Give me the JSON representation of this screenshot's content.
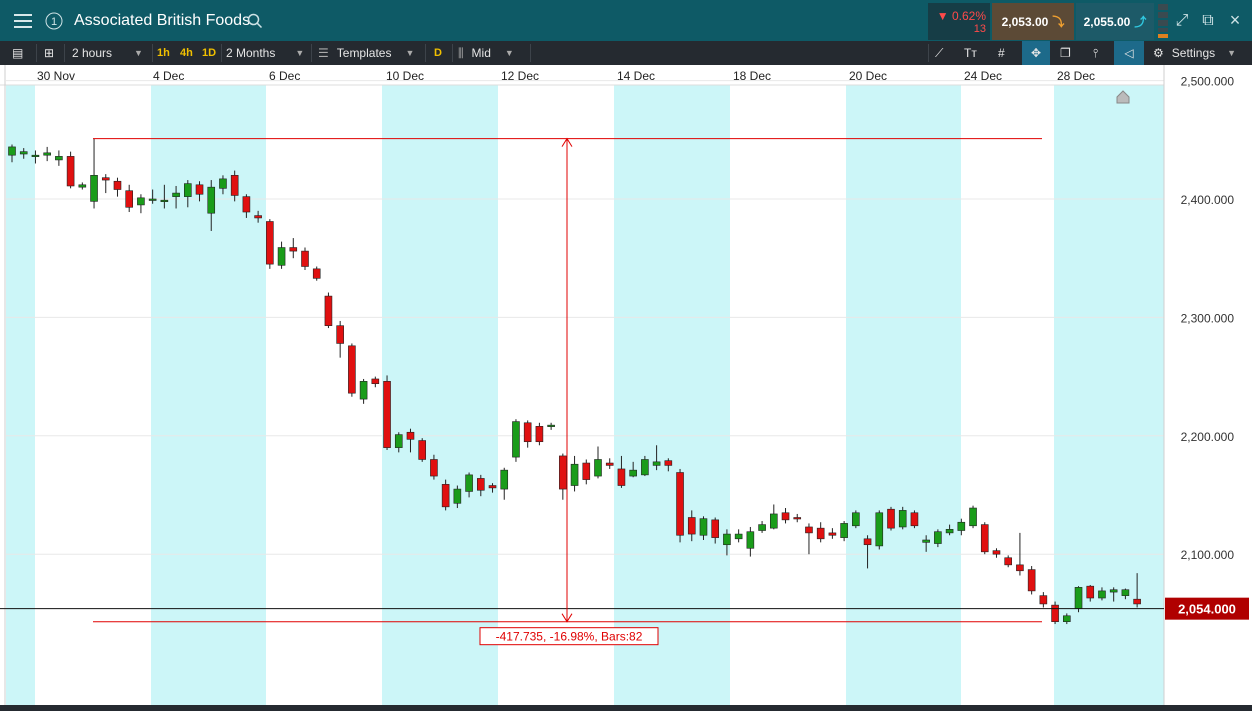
{
  "header": {
    "title": "Associated British Foods",
    "change_pct": "▼ 0.62%",
    "change_abs": "13",
    "sell_price": "2,053.00",
    "buy_price": "2,055.00"
  },
  "toolbar": {
    "interval": "2 hours",
    "quick_1h": "1h",
    "quick_4h": "4h",
    "quick_1d": "1D",
    "range": "2 Months",
    "templates": "Templates",
    "d_badge": "D",
    "price_type": "Mid",
    "settings": "Settings"
  },
  "colors": {
    "up": "#1a9c1a",
    "down": "#e01010",
    "band": "#ccf6f8",
    "measure": "#e00000",
    "price_tag": "#b00000"
  },
  "chart_data": {
    "type": "candlestick",
    "x_labels": [
      "30 Nov",
      "4 Dec",
      "6 Dec",
      "10 Dec",
      "12 Dec",
      "14 Dec",
      "18 Dec",
      "20 Dec",
      "24 Dec",
      "28 Dec"
    ],
    "y_ticks": [
      "2,500.000",
      "2,400.000",
      "2,300.000",
      "2,200.000",
      "2,100.000"
    ],
    "y_tick_values": [
      2500,
      2400,
      2300,
      2200,
      2100
    ],
    "ylim": [
      2030,
      2510
    ],
    "current_price": 2054,
    "current_price_label": "2,054.000",
    "measure": {
      "high": 2451,
      "low": 2043,
      "label": "-417.735, -16.98%, Bars:82"
    },
    "candles": [
      [
        2437,
        2444,
        2431,
        2446
      ],
      [
        2438,
        2440,
        2434,
        2443
      ],
      [
        2436,
        2437,
        2430,
        2441
      ],
      [
        2437,
        2439,
        2432,
        2444
      ],
      [
        2433,
        2436,
        2428,
        2441
      ],
      [
        2436,
        2411,
        2409,
        2440
      ],
      [
        2410,
        2412,
        2408,
        2414
      ],
      [
        2398,
        2420,
        2392,
        2451
      ],
      [
        2418,
        2416,
        2405,
        2421
      ],
      [
        2415,
        2408,
        2402,
        2418
      ],
      [
        2407,
        2393,
        2389,
        2412
      ],
      [
        2395,
        2401,
        2388,
        2404
      ],
      [
        2399,
        2400,
        2396,
        2408
      ],
      [
        2399,
        2399,
        2392,
        2412
      ],
      [
        2402,
        2405,
        2392,
        2411
      ],
      [
        2402,
        2413,
        2393,
        2416
      ],
      [
        2412,
        2404,
        2398,
        2415
      ],
      [
        2388,
        2410,
        2373,
        2416
      ],
      [
        2409,
        2417,
        2404,
        2420
      ],
      [
        2420,
        2403,
        2398,
        2424
      ],
      [
        2402,
        2389,
        2384,
        2404
      ],
      [
        2386,
        2384,
        2380,
        2390
      ],
      [
        2381,
        2345,
        2341,
        2383
      ],
      [
        2344,
        2359,
        2341,
        2364
      ],
      [
        2359,
        2356,
        2350,
        2367
      ],
      [
        2356,
        2343,
        2340,
        2359
      ],
      [
        2341,
        2333,
        2331,
        2343
      ],
      [
        2318,
        2293,
        2291,
        2321
      ],
      [
        2293,
        2278,
        2266,
        2297
      ],
      [
        2276,
        2236,
        2233,
        2278
      ],
      [
        2231,
        2246,
        2227,
        2248
      ],
      [
        2248,
        2244,
        2241,
        2250
      ],
      [
        2246,
        2190,
        2188,
        2251
      ],
      [
        2190,
        2201,
        2186,
        2203
      ],
      [
        2203,
        2197,
        2186,
        2206
      ],
      [
        2196,
        2180,
        2178,
        2198
      ],
      [
        2180,
        2166,
        2163,
        2184
      ],
      [
        2159,
        2140,
        2137,
        2163
      ],
      [
        2143,
        2155,
        2139,
        2158
      ],
      [
        2153,
        2167,
        2148,
        2169
      ],
      [
        2164,
        2154,
        2149,
        2167
      ],
      [
        2158,
        2156,
        2152,
        2160
      ],
      [
        2155,
        2171,
        2146,
        2173
      ],
      [
        2182,
        2212,
        2178,
        2214
      ],
      [
        2211,
        2195,
        2190,
        2213
      ],
      [
        2208,
        2195,
        2192,
        2211
      ],
      [
        2208,
        2209,
        2205,
        2211
      ],
      [
        2183,
        2155,
        2146,
        2185
      ],
      [
        2158,
        2176,
        2153,
        2183
      ],
      [
        2177,
        2163,
        2159,
        2180
      ],
      [
        2166,
        2180,
        2164,
        2191
      ],
      [
        2177,
        2175,
        2172,
        2181
      ],
      [
        2172,
        2158,
        2156,
        2183
      ],
      [
        2166,
        2171,
        2165,
        2178
      ],
      [
        2167,
        2180,
        2166,
        2183
      ],
      [
        2175,
        2178,
        2171,
        2192
      ],
      [
        2179,
        2175,
        2170,
        2181
      ],
      [
        2169,
        2116,
        2110,
        2172
      ],
      [
        2131,
        2117,
        2111,
        2137
      ],
      [
        2116,
        2130,
        2112,
        2132
      ],
      [
        2129,
        2114,
        2109,
        2131
      ],
      [
        2108,
        2117,
        2099,
        2121
      ],
      [
        2113,
        2117,
        2110,
        2121
      ],
      [
        2105,
        2119,
        2098,
        2123
      ],
      [
        2120,
        2125,
        2118,
        2128
      ],
      [
        2122,
        2134,
        2121,
        2142
      ],
      [
        2135,
        2129,
        2126,
        2139
      ],
      [
        2131,
        2130,
        2127,
        2134
      ],
      [
        2123,
        2118,
        2100,
        2126
      ],
      [
        2122,
        2113,
        2110,
        2127
      ],
      [
        2118,
        2116,
        2113,
        2122
      ],
      [
        2114,
        2126,
        2111,
        2128
      ],
      [
        2124,
        2135,
        2122,
        2137
      ],
      [
        2113,
        2108,
        2088,
        2116
      ],
      [
        2107,
        2135,
        2104,
        2137
      ],
      [
        2138,
        2122,
        2120,
        2140
      ],
      [
        2123,
        2137,
        2121,
        2140
      ],
      [
        2135,
        2124,
        2122,
        2137
      ],
      [
        2110,
        2112,
        2102,
        2116
      ],
      [
        2109,
        2119,
        2106,
        2121
      ],
      [
        2118,
        2121,
        2116,
        2125
      ],
      [
        2120,
        2127,
        2116,
        2130
      ],
      [
        2124,
        2139,
        2122,
        2141
      ],
      [
        2125,
        2102,
        2100,
        2127
      ],
      [
        2103,
        2100,
        2097,
        2105
      ],
      [
        2097,
        2091,
        2089,
        2099
      ],
      [
        2091,
        2086,
        2082,
        2118
      ],
      [
        2087,
        2069,
        2066,
        2090
      ],
      [
        2065,
        2058,
        2055,
        2068
      ],
      [
        2057,
        2043,
        2041,
        2060
      ],
      [
        2043,
        2048,
        2041,
        2050
      ],
      [
        2054,
        2072,
        2051,
        2073
      ],
      [
        2073,
        2063,
        2060,
        2074
      ],
      [
        2063,
        2069,
        2061,
        2072
      ],
      [
        2068,
        2070,
        2060,
        2072
      ],
      [
        2065,
        2070,
        2062,
        2071
      ],
      [
        2062,
        2058,
        2055,
        2084
      ]
    ]
  }
}
